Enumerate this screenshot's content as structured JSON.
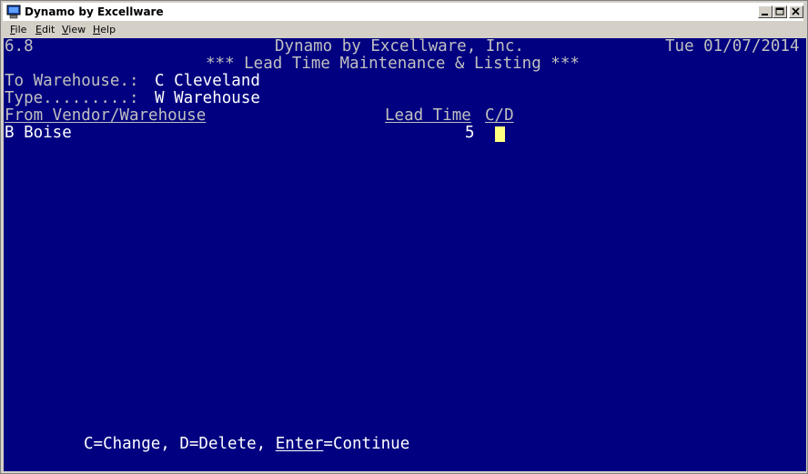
{
  "window": {
    "title": "Dynamo by Excellware"
  },
  "menu": {
    "file": {
      "mnemonic": "F",
      "rest": "ile"
    },
    "edit": {
      "mnemonic": "E",
      "rest": "dit"
    },
    "view": {
      "mnemonic": "V",
      "rest": "iew"
    },
    "help": {
      "mnemonic": "H",
      "rest": "elp"
    }
  },
  "header": {
    "version": "6.8",
    "company": "Dynamo by Excellware, Inc.",
    "date": "Tue 01/07/2014",
    "title": "*** Lead Time Maintenance & Listing ***"
  },
  "fields": {
    "to_warehouse_label": "To Warehouse.:",
    "to_warehouse_value": "C Cleveland",
    "type_label": "Type.........:",
    "type_value": "W Warehouse"
  },
  "table": {
    "col_from": "From Vendor/Warehouse",
    "col_lead": "Lead Time",
    "col_cd": "C/D",
    "rows": [
      {
        "from": "B Boise",
        "lead_time": "5",
        "cd": ""
      }
    ]
  },
  "footer": {
    "prefix": "C=Change, D=Delete, ",
    "enter": "Enter",
    "suffix": "=Continue"
  },
  "colors": {
    "terminal_bg": "#000080",
    "terminal_fg": "#c0c0c0",
    "cursor": "#ffff80"
  }
}
